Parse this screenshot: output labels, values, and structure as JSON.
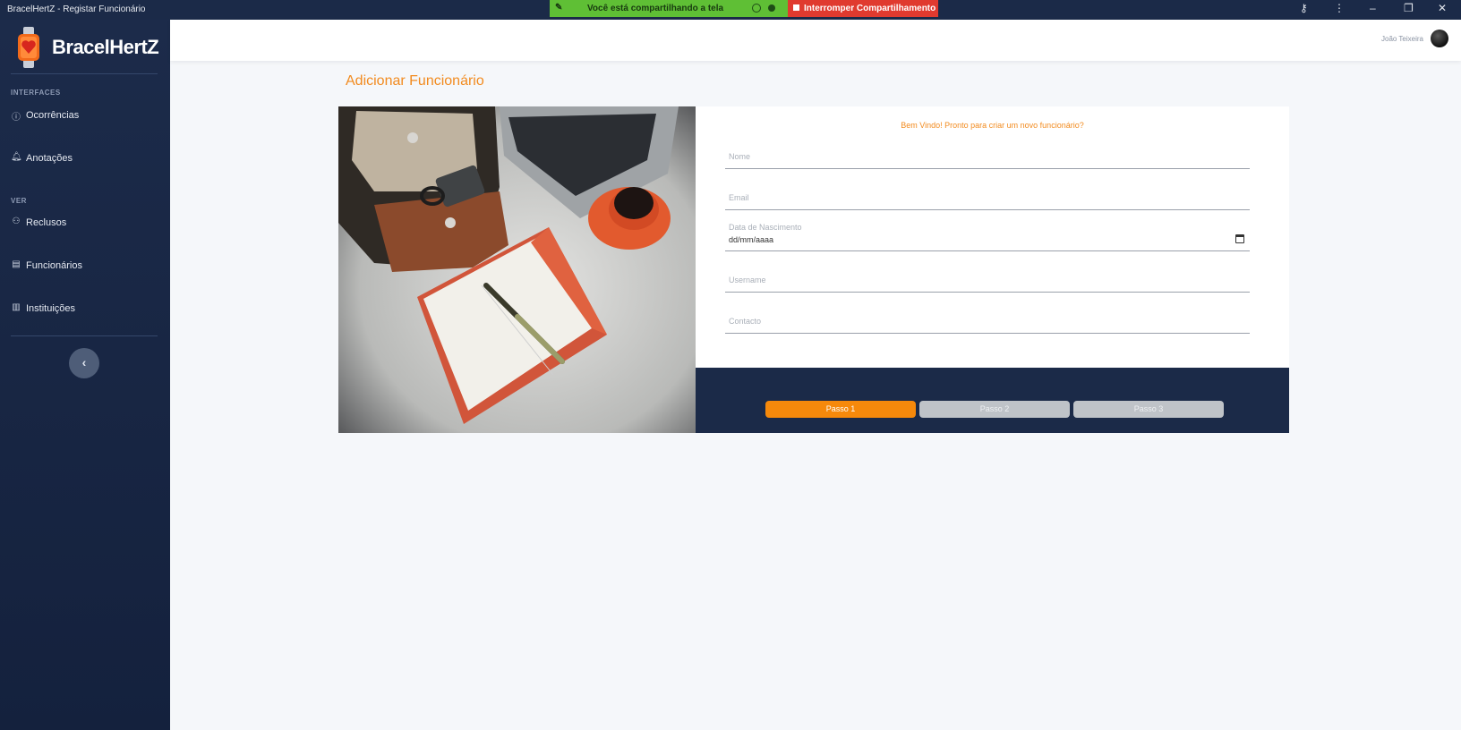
{
  "window": {
    "title": "BracelHertZ - Registar Funcionário",
    "sharing_text": "Você está compartilhando a tela",
    "stop_sharing_label": "Interromper Compartilhamento"
  },
  "sidebar": {
    "brand": "BracelHertZ",
    "sections": [
      {
        "label": "INTERFACES",
        "items": [
          {
            "label": "Ocorrências",
            "icon": "info-circle-icon"
          },
          {
            "label": "Anotações",
            "icon": "bell-icon"
          }
        ]
      },
      {
        "label": "VER",
        "items": [
          {
            "label": "Reclusos",
            "icon": "users-icon"
          },
          {
            "label": "Funcionários",
            "icon": "id-card-icon"
          },
          {
            "label": "Instituições",
            "icon": "bar-chart-icon"
          }
        ]
      }
    ],
    "collapse_symbol": "‹"
  },
  "topbar": {
    "user_name": "João Teixeira"
  },
  "main": {
    "page_title": "Adicionar Funcionário",
    "form": {
      "greeting": "Bem Vindo! Pronto para criar um novo funcionário?",
      "fields": [
        {
          "placeholder": "Nome"
        },
        {
          "placeholder": "Email"
        },
        {
          "label": "Data de Nascimento",
          "value": "dd/mm/aaaa"
        },
        {
          "placeholder": "Username"
        },
        {
          "placeholder": "Contacto"
        }
      ]
    },
    "steps": [
      {
        "label": "Passo 1",
        "active": true
      },
      {
        "label": "Passo 2",
        "active": false
      },
      {
        "label": "Passo 3",
        "active": false
      }
    ]
  },
  "colors": {
    "accent": "#f6890b",
    "sidebar_bg": "#1c2b4a",
    "share_green": "#5fbf35",
    "share_red": "#e03a2f"
  }
}
